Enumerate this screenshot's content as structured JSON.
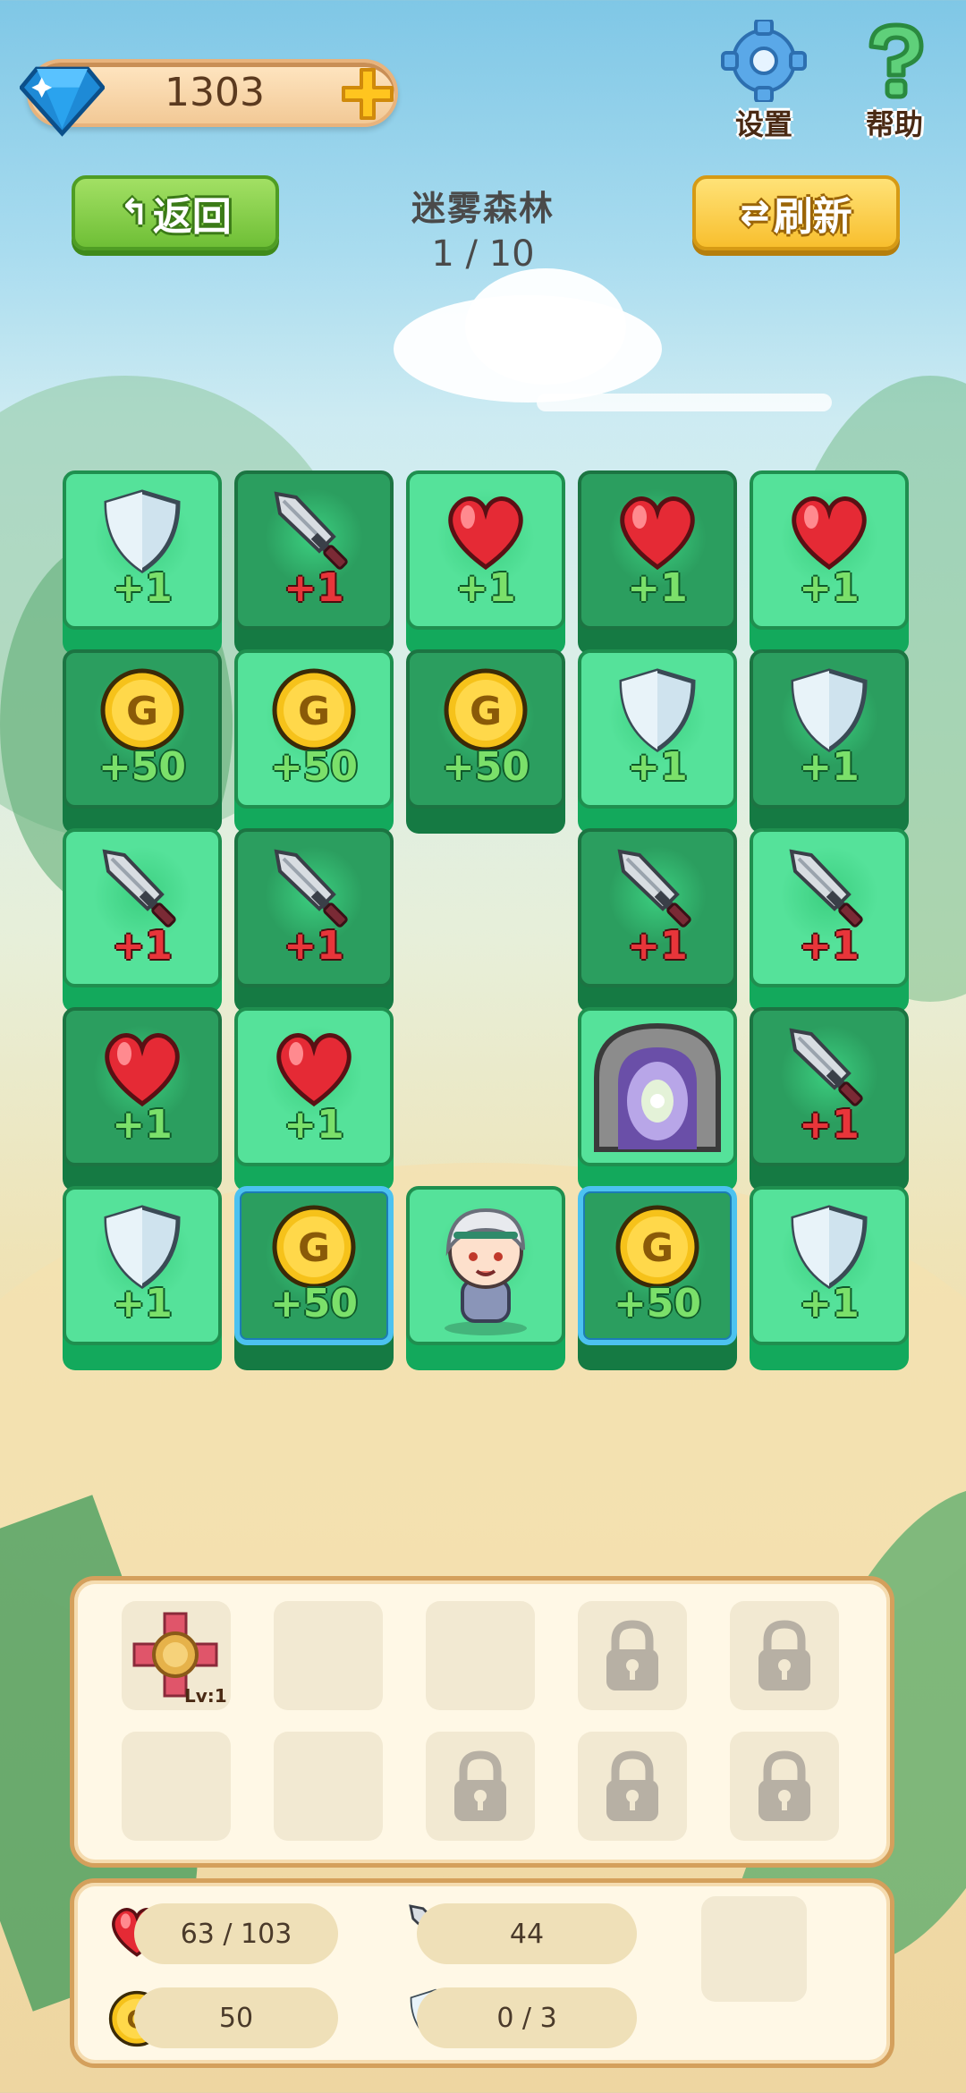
{
  "header": {
    "gems": "1303",
    "settings_label": "设置",
    "help_label": "帮助",
    "back_label": "返回",
    "refresh_label": "刷新",
    "level_name": "迷雾森林",
    "level_progress": "1 / 10"
  },
  "grid": {
    "rows": [
      [
        {
          "type": "shield",
          "text": "+1",
          "bg": "light"
        },
        {
          "type": "sword",
          "text": "+1",
          "bg": "dark"
        },
        {
          "type": "heart",
          "text": "+1",
          "bg": "light"
        },
        {
          "type": "heart",
          "text": "+1",
          "bg": "dark"
        },
        {
          "type": "heart",
          "text": "+1",
          "bg": "light"
        }
      ],
      [
        {
          "type": "coin",
          "text": "+50",
          "bg": "dark"
        },
        {
          "type": "coin",
          "text": "+50",
          "bg": "light"
        },
        {
          "type": "coin",
          "text": "+50",
          "bg": "dark"
        },
        {
          "type": "shield",
          "text": "+1",
          "bg": "light"
        },
        {
          "type": "shield",
          "text": "+1",
          "bg": "dark"
        }
      ],
      [
        {
          "type": "sword",
          "text": "+1",
          "bg": "light"
        },
        {
          "type": "sword",
          "text": "+1",
          "bg": "dark"
        },
        {
          "type": "empty"
        },
        {
          "type": "sword",
          "text": "+1",
          "bg": "dark"
        },
        {
          "type": "sword",
          "text": "+1",
          "bg": "light"
        }
      ],
      [
        {
          "type": "heart",
          "text": "+1",
          "bg": "dark"
        },
        {
          "type": "heart",
          "text": "+1",
          "bg": "light"
        },
        {
          "type": "empty"
        },
        {
          "type": "portal",
          "text": "",
          "bg": "light"
        },
        {
          "type": "sword",
          "text": "+1",
          "bg": "dark"
        }
      ],
      [
        {
          "type": "shield",
          "text": "+1",
          "bg": "light"
        },
        {
          "type": "coin",
          "text": "+50",
          "bg": "dark",
          "selected": true
        },
        {
          "type": "hero",
          "text": "",
          "bg": "light"
        },
        {
          "type": "coin",
          "text": "+50",
          "bg": "dark",
          "selected": true
        },
        {
          "type": "shield",
          "text": "+1",
          "bg": "light"
        }
      ]
    ]
  },
  "inventory": {
    "slots": [
      {
        "state": "item",
        "level": "Lv:1"
      },
      {
        "state": "empty"
      },
      {
        "state": "empty"
      },
      {
        "state": "locked"
      },
      {
        "state": "locked"
      },
      {
        "state": "empty"
      },
      {
        "state": "empty"
      },
      {
        "state": "locked"
      },
      {
        "state": "locked"
      },
      {
        "state": "locked"
      }
    ]
  },
  "stats": {
    "hp": "63 / 103",
    "attack": "44",
    "gold": "50",
    "shield": "0 / 3"
  },
  "colors": {
    "tile_light": "#55e29a",
    "tile_dark": "#2b9e5f",
    "selected_border": "#4cc2f0",
    "plus_green": "#7be06a",
    "plus_red": "#e8353a"
  }
}
